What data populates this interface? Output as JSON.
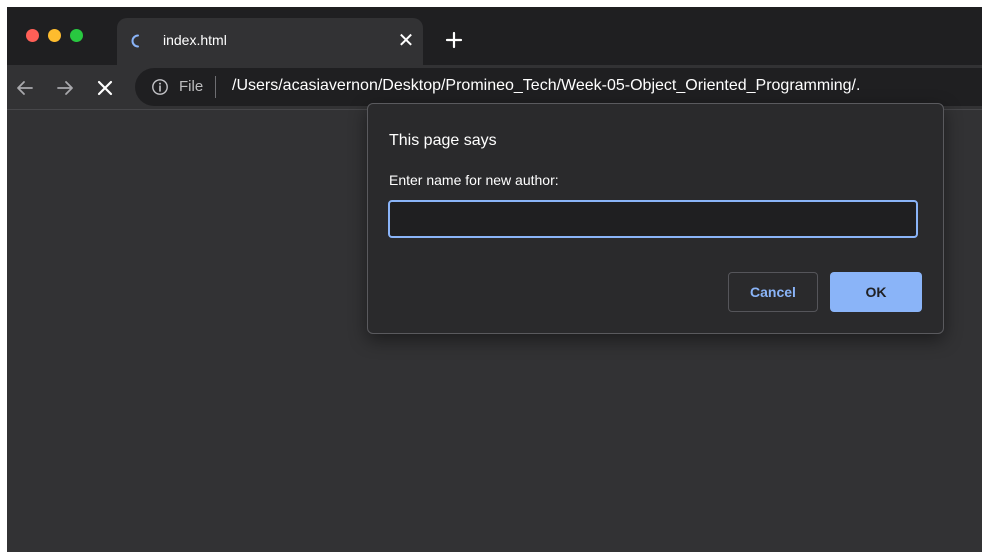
{
  "browser": {
    "tab": {
      "title": "index.html",
      "close_glyph": "✕",
      "icon": "loading-spinner-icon"
    },
    "new_tab_icon": "plus-icon",
    "toolbar": {
      "back_icon": "arrow-left-icon",
      "forward_icon": "arrow-right-icon",
      "stop_icon": "close-icon"
    },
    "omnibox": {
      "info_icon": "info-icon",
      "scheme_label": "File",
      "url": "/Users/acasiavernon/Desktop/Promineo_Tech/Week-05-Object_Oriented_Programming/."
    }
  },
  "dialog": {
    "title": "This page says",
    "message": "Enter name for new author:",
    "input_value": "",
    "cancel_label": "Cancel",
    "ok_label": "OK"
  },
  "colors": {
    "accent": "#8ab4f8",
    "page_background": "#323234",
    "tabstrip_background": "#1f1f21",
    "traffic_red": "#ff5f57",
    "traffic_yellow": "#febc2e",
    "traffic_green": "#28c840"
  }
}
